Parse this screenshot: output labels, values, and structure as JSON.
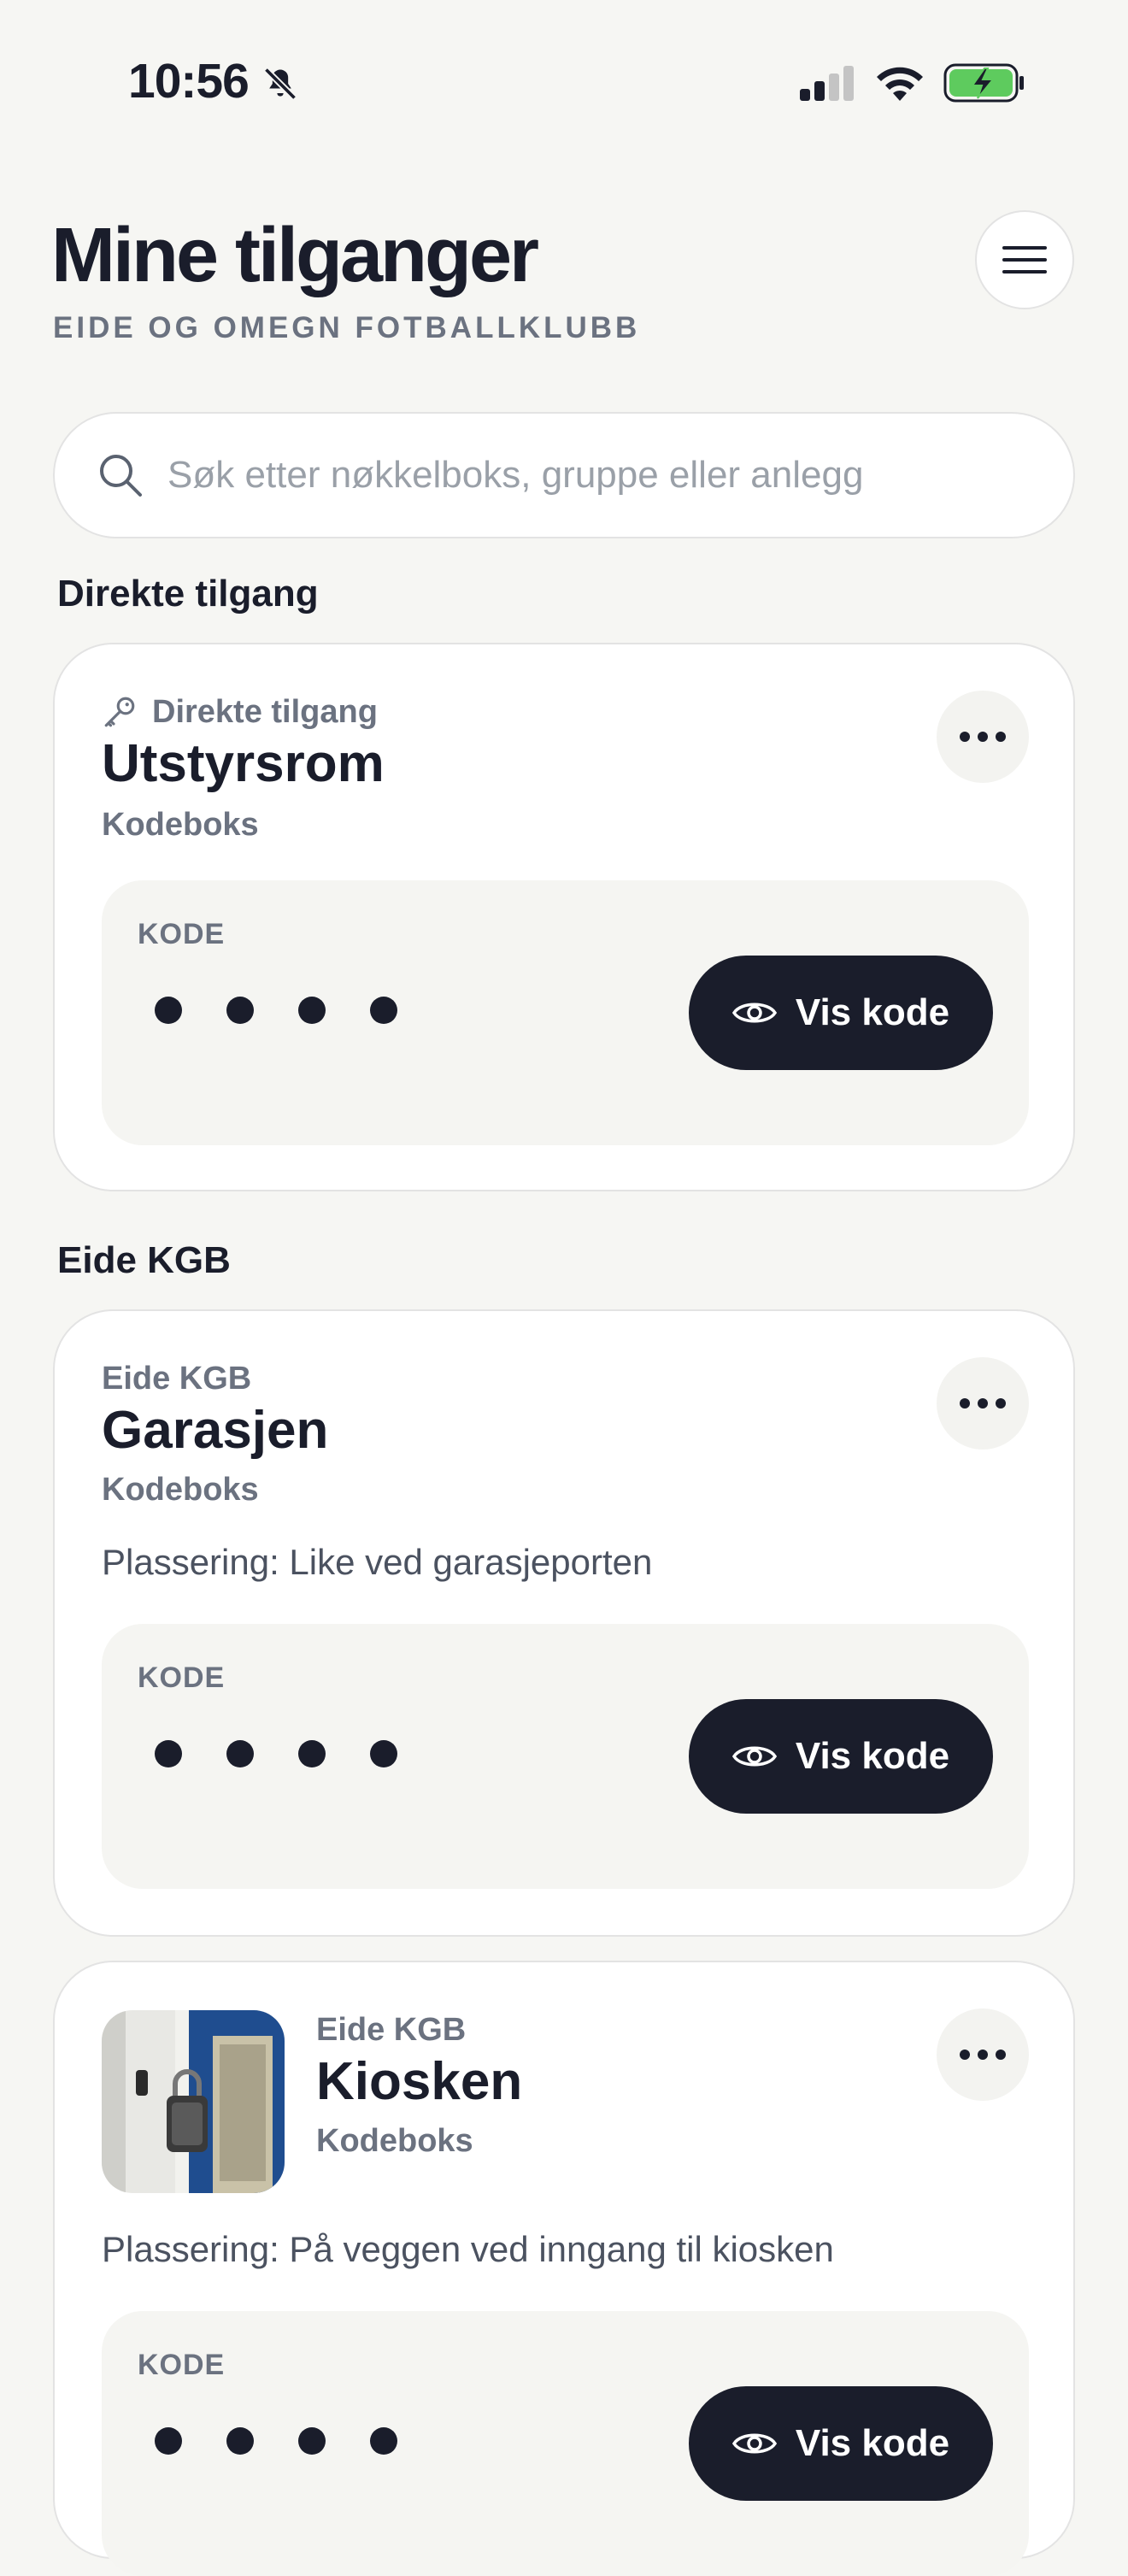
{
  "status_bar": {
    "time": "10:56"
  },
  "header": {
    "title": "Mine tilganger",
    "organization": "EIDE OG OMEGN FOTBALLKLUBB"
  },
  "search": {
    "placeholder": "Søk etter nøkkelboks, gruppe eller anlegg"
  },
  "sections": [
    {
      "title": "Direkte tilgang",
      "cards": [
        {
          "eyebrow": "Direkte tilgang",
          "eyebrow_icon": "key-icon",
          "title": "Utstyrsrom",
          "type": "Kodeboks",
          "code_label": "KODE",
          "code_mask": "••••",
          "button_label": "Vis kode"
        }
      ]
    },
    {
      "title": "Eide KGB",
      "cards": [
        {
          "eyebrow": "Eide KGB",
          "title": "Garasjen",
          "type": "Kodeboks",
          "location": "Plassering: Like ved garasjeporten",
          "code_label": "KODE",
          "code_mask": "••••",
          "button_label": "Vis kode"
        },
        {
          "eyebrow": "Eide KGB",
          "title": "Kiosken",
          "type": "Kodeboks",
          "location": "Plassering: På veggen ved inngang til kiosken",
          "has_photo": true,
          "code_label": "KODE",
          "code_mask": "••••",
          "button_label": "Vis kode"
        }
      ]
    }
  ],
  "colors": {
    "background": "#f6f6f3",
    "dark": "#1a1d2b",
    "muted": "#6b7280",
    "battery": "#5ecb5e"
  }
}
